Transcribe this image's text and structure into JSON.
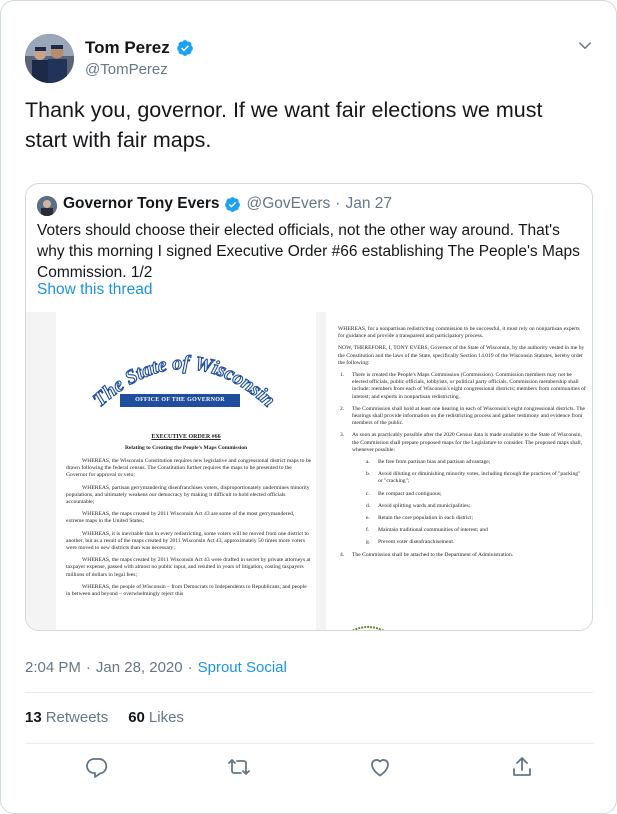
{
  "tweet": {
    "author": {
      "name": "Tom Perez",
      "handle": "@TomPerez"
    },
    "text": "Thank you, governor. If we want fair elections we must start with fair maps.",
    "timestamp": "2:04 PM · Jan 28, 2020",
    "time": "2:04 PM",
    "date": "Jan 28, 2020",
    "separator": "·",
    "source": "Sprout Social",
    "retweets": {
      "count": "13",
      "label": "Retweets"
    },
    "likes": {
      "count": "60",
      "label": "Likes"
    }
  },
  "quote": {
    "author": {
      "name": "Governor Tony Evers",
      "handle": "@GovEvers"
    },
    "separator": "·",
    "date": "Jan 27",
    "text": "Voters should choose their elected officials, not the other way around. That's why this morning I signed Executive Order #66 establishing The People's Maps Commission. 1/2",
    "show_thread": "Show this thread"
  },
  "document": {
    "state_title": "The State of Wisconsin",
    "office": "OFFICE OF THE GOVERNOR",
    "order_title": "EXECUTIVE ORDER #66",
    "order_subtitle": "Relating to Creating the People's Maps Commission",
    "left_paragraphs": [
      "WHEREAS, the Wisconsin Constitution requires new legislative and congressional district maps to be drawn following the federal census. The Constitution further requires the maps to be presented to the Governor for approval or veto;",
      "WHEREAS, partisan gerrymandering disenfranchises voters, disproportionately undermines minority populations, and ultimately weakens our democracy by making it difficult to hold elected officials accountable;",
      "WHEREAS, the maps created by 2011 Wisconsin Act 43 are some of the most gerrymandered, extreme maps in the United States;",
      "WHEREAS, it is inevitable that in every redistricting, some voters will be moved from one district to another, but as a result of the maps created by 2011 Wisconsin Act 43, approximately 50 times more voters were moved to new districts than was necessary;",
      "WHEREAS, the maps created by 2011 Wisconsin Act 43 were drafted in secret by private attorneys at taxpayer expense, passed with almost no public input, and resulted in years of litigation, costing taxpayers millions of dollars in legal fees;",
      "WHEREAS, the people of Wisconsin – from Democrats to Independents to Republicans, and people in between and beyond – overwhelmingly reject this"
    ],
    "right_intro": "WHEREAS, for a nonpartisan redistricting commission to be successful, it must rely on nonpartisan experts for guidance and provide a transparent and participatory process.",
    "right_now": "NOW, THEREFORE, I, TONY EVERS, Governor of the State of Wisconsin, by the authority vested in me by the Constitution and the laws of the State, specifically Section 14.019 of the Wisconsin Statutes, hereby order the following:",
    "items": [
      {
        "n": "1.",
        "text": "There is created the People's Maps Commission (Commission). Commission members may not be elected officials, public officials, lobbyists, or political party officials. Commission membership shall include: members from each of Wisconsin's eight congressional districts; members from communities of interest; and experts in nonpartisan redistricting."
      },
      {
        "n": "2.",
        "text": "The Commission shall hold at least one hearing in each of Wisconsin's eight congressional districts. The hearings shall provide information on the redistricting process and gather testimony and evidence from members of the public."
      },
      {
        "n": "3.",
        "text": "As soon as practicably possible after the 2020 Census data is made available to the State of Wisconsin, the Commission shall prepare proposed maps for the Legislature to consider. The proposed maps shall, whenever possible:"
      }
    ],
    "subitems": [
      {
        "n": "a.",
        "text": "Be free from partisan bias and partisan advantage;"
      },
      {
        "n": "b.",
        "text": "Avoid diluting or diminishing minority votes, including through the practices of \"packing\" or \"cracking\";"
      },
      {
        "n": "c.",
        "text": "Be compact and contiguous;"
      },
      {
        "n": "d.",
        "text": "Avoid splitting wards and municipalities;"
      },
      {
        "n": "e.",
        "text": "Retain the core population in each district;"
      },
      {
        "n": "f.",
        "text": "Maintain traditional communities of interest; and"
      },
      {
        "n": "g.",
        "text": "Prevent voter disenfranchisement."
      }
    ],
    "item4": {
      "n": "4.",
      "text": "The Commission shall be attached to the Department of Administration."
    }
  },
  "icons": {
    "verified": "verified-badge-icon",
    "more": "chevron-down-icon",
    "reply": "reply-icon",
    "retweet": "retweet-icon",
    "like": "heart-icon",
    "share": "share-icon"
  },
  "colors": {
    "accent": "#1b95e0",
    "muted": "#657786",
    "text": "#14171a",
    "border": "#cfd9de",
    "office_bar": "#1f4e9e"
  }
}
